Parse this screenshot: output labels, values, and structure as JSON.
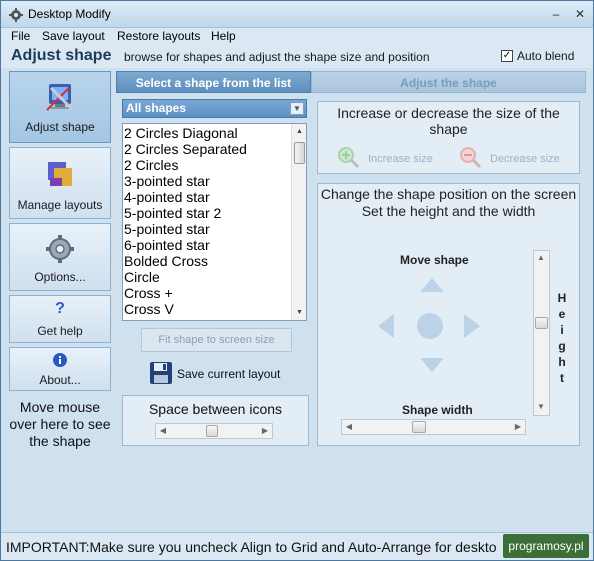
{
  "window": {
    "title": "Desktop Modify",
    "minimize": "–",
    "close": "✕"
  },
  "menu": [
    "File",
    "Save layout",
    "Restore layouts",
    "Help"
  ],
  "header": {
    "title": "Adjust shape",
    "description": "browse for shapes and adjust the shape size and position",
    "auto_blend_label": "Auto blend",
    "auto_blend_checked": true
  },
  "sidebar": {
    "items": [
      {
        "label": "Adjust shape",
        "icon": "adjust-shape-icon",
        "active": true
      },
      {
        "label": "Manage layouts",
        "icon": "manage-layouts-icon",
        "active": false
      },
      {
        "label": "Options...",
        "icon": "gear-icon",
        "active": false
      },
      {
        "label": "Get help",
        "icon": "question-icon",
        "active": false
      },
      {
        "label": "About...",
        "icon": "info-icon",
        "active": false
      }
    ],
    "hint": "Move mouse over here to see the shape"
  },
  "tabs": {
    "select": "Select a shape from the list",
    "adjust": "Adjust the shape"
  },
  "shape_filter": {
    "selected": "All shapes"
  },
  "shapes": [
    "2 Circles Diagonal",
    "2 Circles Separated",
    "2 Circles",
    "3-pointed star",
    "4-pointed star",
    "5-pointed star 2",
    "5-pointed star",
    "6-pointed star",
    "Bolded Cross",
    "Circle",
    "Cross +",
    "Cross V"
  ],
  "buttons": {
    "fit": "Fit shape to screen size",
    "save": "Save current layout"
  },
  "spacing": {
    "label": "Space between icons"
  },
  "size": {
    "title": "Increase or decrease the size of the shape",
    "increase": "Increase size",
    "decrease": "Decrease size"
  },
  "position": {
    "title": "Change the shape position on the screen  Set the height and the width",
    "move_label": "Move shape",
    "width_label": "Shape width",
    "height_label": "Height"
  },
  "footer": {
    "text": "IMPORTANT:Make sure you uncheck Align to Grid and Auto-Arrange for deskto",
    "watermark": "programosy.pl"
  },
  "colors": {
    "tab_active": "#5d8fbe",
    "tab_inactive": "#a9c5de",
    "panel": "#e3edf6",
    "window": "#cfe0ef"
  }
}
